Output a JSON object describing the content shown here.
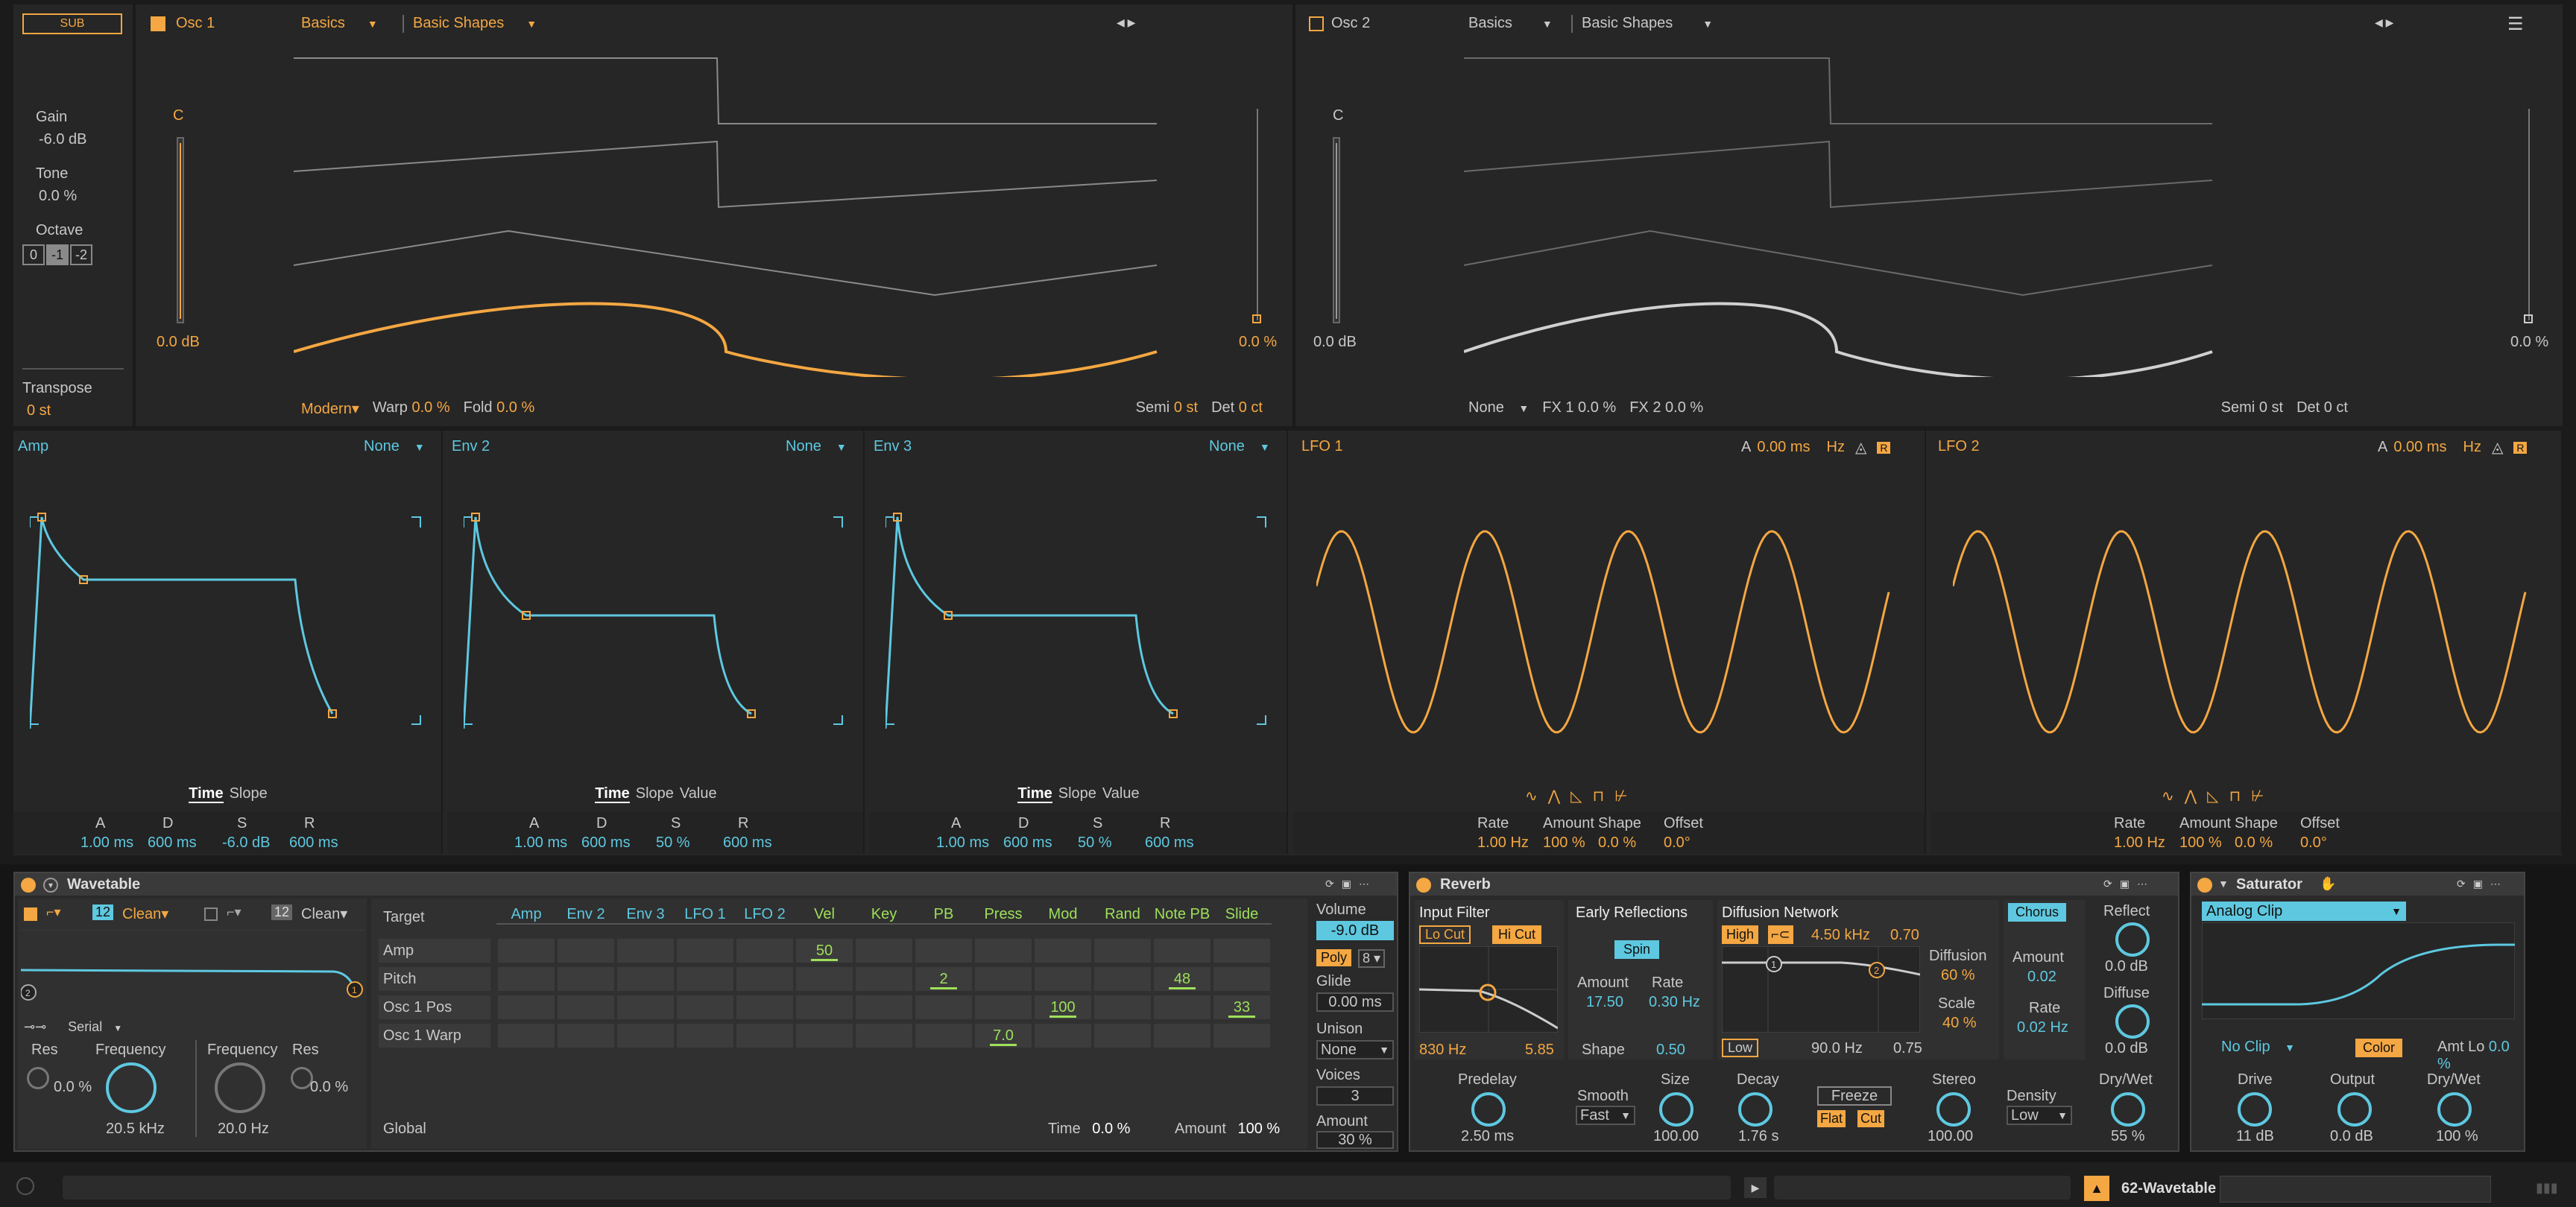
{
  "colors": {
    "orange": "#f4a742",
    "cyan": "#5ec8e0",
    "green": "#9ee05a",
    "bg": "#262626",
    "panel": "#232323",
    "grey": "#8a8a8a"
  },
  "sub": {
    "label": "SUB",
    "gain_label": "Gain",
    "gain_value": "-6.0 dB",
    "tone_label": "Tone",
    "tone_value": "0.0 %",
    "octave_label": "Octave",
    "octave_options": [
      "0",
      "-1",
      "-2"
    ],
    "transpose_label": "Transpose",
    "transpose_value": "0 st"
  },
  "osc1": {
    "title": "Osc 1",
    "category": "Basics",
    "wavetable": "Basic Shapes",
    "note": "C",
    "level": "0.0 dB",
    "pan": "0.0 %",
    "mode": "Modern",
    "warp_label": "Warp",
    "warp_value": "0.0 %",
    "fold_label": "Fold",
    "fold_value": "0.0 %",
    "semi_label": "Semi",
    "semi_value": "0 st",
    "det_label": "Det",
    "det_value": "0 ct"
  },
  "osc2": {
    "title": "Osc 2",
    "category": "Basics",
    "wavetable": "Basic Shapes",
    "note": "C",
    "level": "0.0 dB",
    "pan": "0.0 %",
    "fx_mode": "None",
    "fx1_label": "FX 1",
    "fx1_value": "0.0 %",
    "fx2_label": "FX 2",
    "fx2_value": "0.0 %",
    "semi_label": "Semi",
    "semi_value": "0 st",
    "det_label": "Det",
    "det_value": "0 ct"
  },
  "envelopes": [
    {
      "title": "Amp",
      "mode": "None",
      "tabs": [
        "Time",
        "Slope"
      ],
      "params": [
        {
          "label": "A",
          "value": "1.00 ms"
        },
        {
          "label": "D",
          "value": "600 ms"
        },
        {
          "label": "S",
          "value": "-6.0 dB"
        },
        {
          "label": "R",
          "value": "600 ms"
        }
      ]
    },
    {
      "title": "Env 2",
      "mode": "None",
      "tabs": [
        "Time",
        "Slope",
        "Value"
      ],
      "params": [
        {
          "label": "A",
          "value": "1.00 ms"
        },
        {
          "label": "D",
          "value": "600 ms"
        },
        {
          "label": "S",
          "value": "50 %"
        },
        {
          "label": "R",
          "value": "600 ms"
        }
      ]
    },
    {
      "title": "Env 3",
      "mode": "None",
      "tabs": [
        "Time",
        "Slope",
        "Value"
      ],
      "params": [
        {
          "label": "A",
          "value": "1.00 ms"
        },
        {
          "label": "D",
          "value": "600 ms"
        },
        {
          "label": "S",
          "value": "50 %"
        },
        {
          "label": "R",
          "value": "600 ms"
        }
      ]
    }
  ],
  "lfos": [
    {
      "title": "LFO 1",
      "attack_label": "A",
      "attack_value": "0.00 ms",
      "unit": "Hz",
      "retrigger": "R",
      "params": [
        {
          "label": "Rate",
          "value": "1.00 Hz"
        },
        {
          "label": "Amount",
          "value": "100 %"
        },
        {
          "label": "Shape",
          "value": "0.0 %"
        },
        {
          "label": "Offset",
          "value": "0.0°"
        }
      ]
    },
    {
      "title": "LFO 2",
      "attack_label": "A",
      "attack_value": "0.00 ms",
      "unit": "Hz",
      "retrigger": "R",
      "params": [
        {
          "label": "Rate",
          "value": "1.00 Hz"
        },
        {
          "label": "Amount",
          "value": "100 %"
        },
        {
          "label": "Shape",
          "value": "0.0 %"
        },
        {
          "label": "Offset",
          "value": "0.0°"
        }
      ]
    }
  ],
  "wavetable_device": {
    "title": "Wavetable",
    "filter1": {
      "slope": "12",
      "type": "Clean",
      "res_label": "Res",
      "res_value": "0.0 %",
      "freq_label": "Frequency",
      "freq_value": "20.5 kHz"
    },
    "filter2": {
      "slope": "12",
      "type": "Clean",
      "freq_label": "Frequency",
      "freq_value": "20.0 Hz",
      "res_label": "Res",
      "res_value": "0.0 %"
    },
    "routing": "Serial",
    "matrix": {
      "target_header": "Target",
      "columns": [
        "Amp",
        "Env 2",
        "Env 3",
        "LFO 1",
        "LFO 2",
        "Vel",
        "Key",
        "PB",
        "Press",
        "Mod",
        "Rand",
        "Note PB",
        "Slide"
      ],
      "rows": [
        {
          "name": "Amp",
          "cells": [
            "",
            "",
            "",
            "",
            "",
            "50",
            "",
            "",
            "",
            "",
            "",
            "",
            ""
          ]
        },
        {
          "name": "Pitch",
          "cells": [
            "",
            "",
            "",
            "",
            "",
            "",
            "",
            "2",
            "",
            "",
            "",
            "48",
            ""
          ]
        },
        {
          "name": "Osc 1 Pos",
          "cells": [
            "",
            "",
            "",
            "",
            "",
            "",
            "",
            "",
            "",
            "100",
            "",
            "",
            "33"
          ]
        },
        {
          "name": "Osc 1 Warp",
          "cells": [
            "",
            "",
            "",
            "",
            "",
            "",
            "",
            "",
            "7.0",
            "",
            "",
            "",
            ""
          ]
        }
      ],
      "global_label": "Global",
      "time_label": "Time",
      "time_value": "0.0 %",
      "amount_label": "Amount",
      "amount_value": "100 %"
    },
    "volume_label": "Volume",
    "volume_value": "-9.0 dB",
    "poly_label": "Poly",
    "poly_value": "8",
    "glide_label": "Glide",
    "glide_value": "0.00 ms",
    "unison_label": "Unison",
    "unison_value": "None",
    "voices_label": "Voices",
    "voices_value": "3",
    "amount_label": "Amount",
    "amount_value": "30 %"
  },
  "reverb": {
    "title": "Reverb",
    "input_filter": "Input Filter",
    "lo_cut": "Lo Cut",
    "hi_cut": "Hi Cut",
    "if_freq": "830 Hz",
    "if_width": "5.85",
    "early": "Early Reflections",
    "spin": "Spin",
    "amount_label": "Amount",
    "amount_value": "17.50",
    "rate_label": "Rate",
    "rate_value": "0.30 Hz",
    "shape_label": "Shape",
    "shape_value": "0.50",
    "diffusion_network": "Diffusion Network",
    "high": "High",
    "high_freq": "4.50 kHz",
    "high_val": "0.70",
    "low": "Low",
    "low_freq": "90.0 Hz",
    "low_val": "0.75",
    "diffusion_label": "Diffusion",
    "diffusion_value": "60 %",
    "scale_label": "Scale",
    "scale_value": "40 %",
    "chorus": "Chorus",
    "ch_amount_label": "Amount",
    "ch_amount_value": "0.02",
    "ch_rate_label": "Rate",
    "ch_rate_value": "0.02 Hz",
    "reflect_label": "Reflect",
    "reflect_value": "0.0 dB",
    "diffuse_label": "Diffuse",
    "diffuse_value": "0.0 dB",
    "predelay_label": "Predelay",
    "predelay_value": "2.50 ms",
    "smooth_label": "Smooth",
    "smooth_value": "Fast",
    "size_label": "Size",
    "size_value": "100.00",
    "decay_label": "Decay",
    "decay_value": "1.76 s",
    "freeze": "Freeze",
    "flat": "Flat",
    "cut": "Cut",
    "stereo_label": "Stereo",
    "stereo_value": "100.00",
    "density_label": "Density",
    "density_value": "Low",
    "drywet_label": "Dry/Wet",
    "drywet_value": "55 %"
  },
  "saturator": {
    "title": "Saturator",
    "type": "Analog Clip",
    "clip": "No Clip",
    "color": "Color",
    "amtlo_label": "Amt Lo",
    "amtlo_value": "0.0 %",
    "drive_label": "Drive",
    "drive_value": "11 dB",
    "output_label": "Output",
    "output_value": "0.0 dB",
    "drywet_label": "Dry/Wet",
    "drywet_value": "100 %"
  },
  "statusbar": {
    "track_name": "62-Wavetable"
  }
}
